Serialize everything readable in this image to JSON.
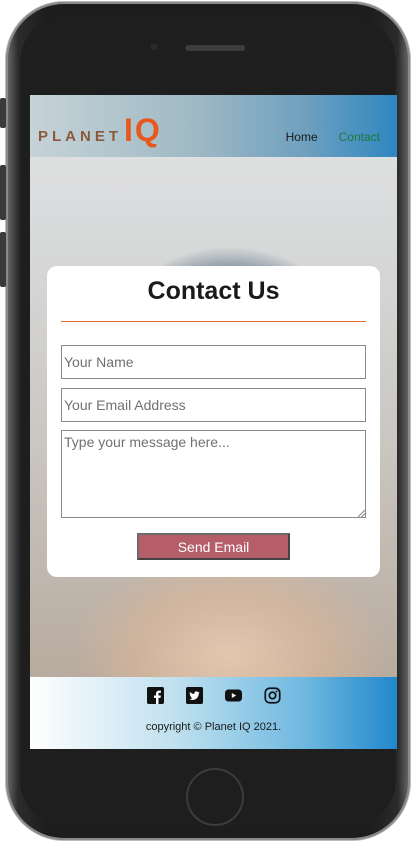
{
  "header": {
    "logo_planet": "PLANET",
    "logo_iq": "IQ",
    "nav": [
      {
        "label": "Home"
      },
      {
        "label": "Contact"
      }
    ]
  },
  "contact": {
    "title": "Contact Us",
    "name_placeholder": "Your Name",
    "email_placeholder": "Your Email Address",
    "message_placeholder": "Type your message here...",
    "send_label": "Send Email"
  },
  "footer": {
    "socials": [
      "facebook-icon",
      "twitter-icon",
      "youtube-icon",
      "instagram-icon"
    ],
    "copyright": "copyright © Planet IQ 2021."
  },
  "colors": {
    "accent": "#e8581e",
    "button": "#b55d69",
    "nav_active": "#1a7a3a"
  }
}
